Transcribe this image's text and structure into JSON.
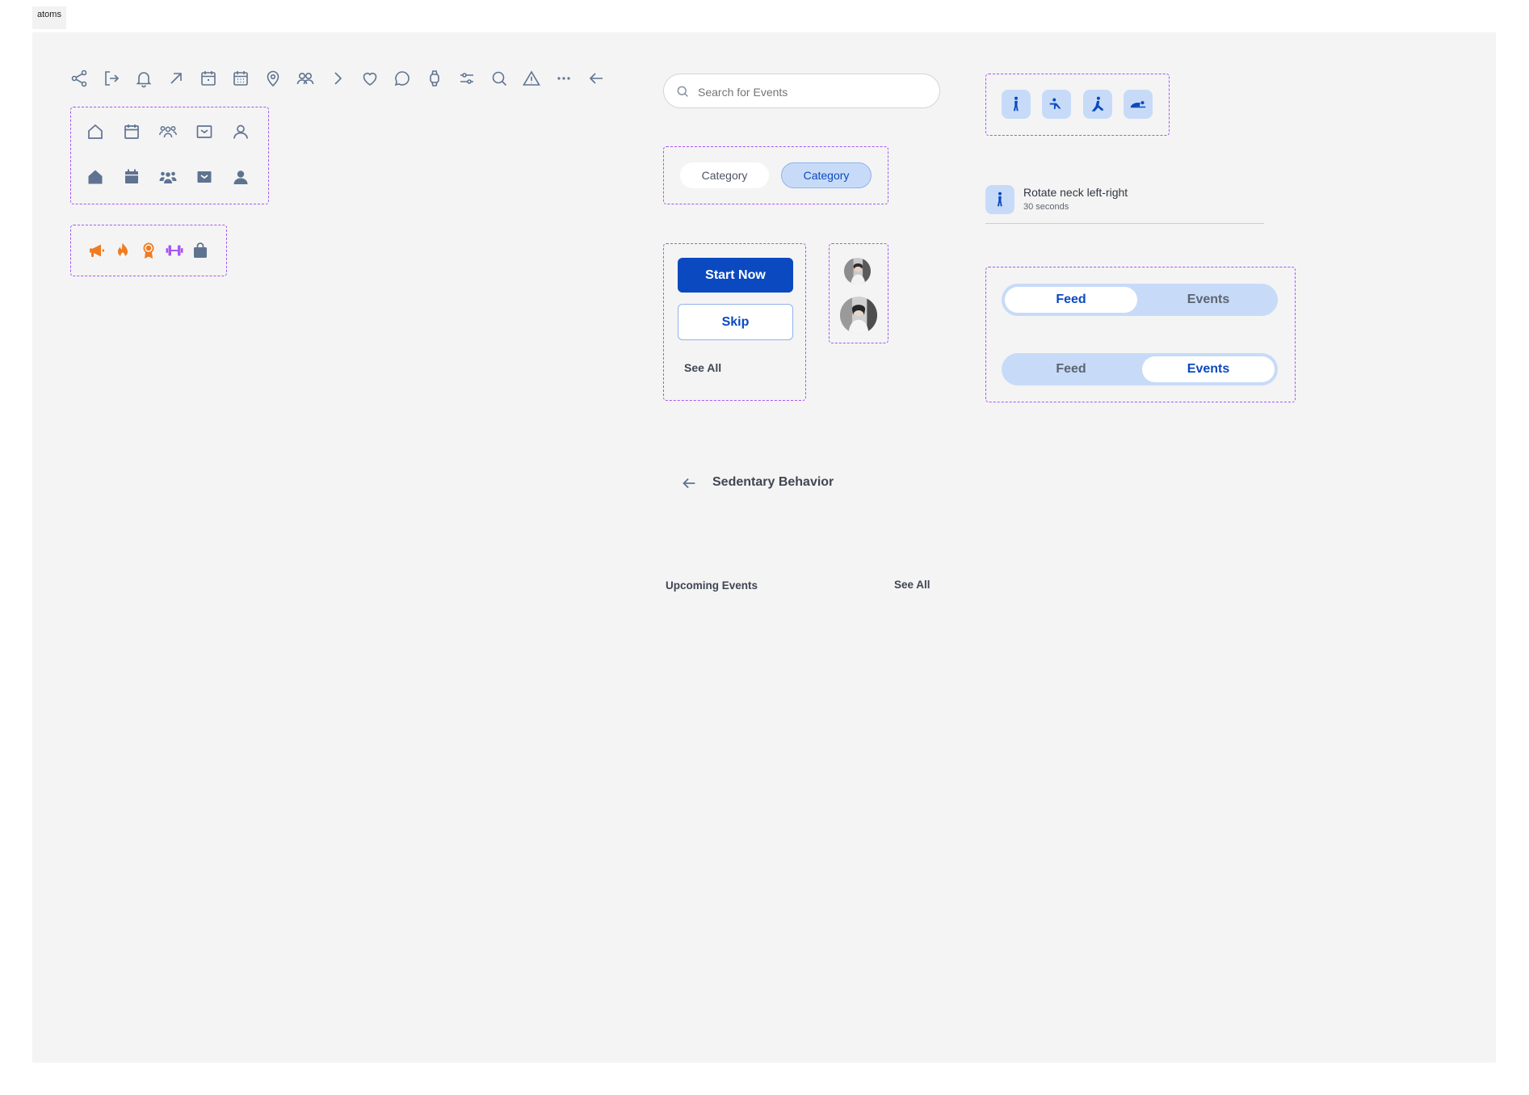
{
  "frame": {
    "label": "atoms"
  },
  "colors": {
    "primary": "#0b49c0",
    "primary_light": "#c7dbf8",
    "icon_gray": "#5f7391",
    "accent_orange": "#f07b20",
    "accent_purple": "#a855f7",
    "dash": "#a855f7",
    "canvas": "#f4f4f4"
  },
  "icon_row": [
    "share-icon",
    "logout-icon",
    "bell-icon",
    "arrow-up-right-icon",
    "calendar-icon",
    "calendar-grid-icon",
    "map-pin-icon",
    "group-icon",
    "chevron-right-icon",
    "heart-icon",
    "chat-icon",
    "watch-icon",
    "sliders-icon",
    "search-icon",
    "warning-icon",
    "more-icon",
    "arrow-left-icon"
  ],
  "nav_icons": {
    "outline": [
      "home-outline-icon",
      "calendar-outline-icon",
      "community-outline-icon",
      "inbox-outline-icon",
      "profile-outline-icon"
    ],
    "filled": [
      "home-filled-icon",
      "calendar-filled-icon",
      "community-filled-icon",
      "inbox-filled-icon",
      "profile-filled-icon"
    ]
  },
  "badge_icons": [
    "megaphone-icon",
    "fire-icon",
    "medal-icon",
    "dumbbell-icon",
    "bag-icon"
  ],
  "search": {
    "placeholder": "Search for Events"
  },
  "pose_icons": [
    "standing-pose-icon",
    "plank-pose-icon",
    "seated-stretch-pose-icon",
    "lying-pose-icon"
  ],
  "categories": [
    {
      "label": "Category",
      "selected": false
    },
    {
      "label": "Category",
      "selected": true
    }
  ],
  "exercise": {
    "title": "Rotate neck left-right",
    "duration": "30 seconds"
  },
  "buttons": {
    "start": "Start Now",
    "skip": "Skip",
    "see_all": "See All"
  },
  "avatars": [
    "avatar-small",
    "avatar-large"
  ],
  "segmented": [
    {
      "options": [
        "Feed",
        "Events"
      ],
      "active": "Feed"
    },
    {
      "options": [
        "Feed",
        "Events"
      ],
      "active": "Events"
    }
  ],
  "header": {
    "title": "Sedentary Behavior"
  },
  "section": {
    "title": "Upcoming Events",
    "see_all": "See All"
  }
}
